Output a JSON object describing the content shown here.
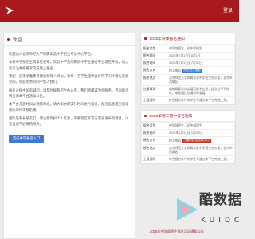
{
  "header": {
    "logo": "school-logo",
    "login": "登录"
  },
  "notice": {
    "title": "欢迎",
    "paragraphs": [
      "欢迎加入北京师范大学附属实验中学招生考试中心平台。",
      "本校中学部招生简章已发布，实验中学及附属初中学生报名平台现已开放，请大家关注并按要求完成网上报名。",
      "我们一直秉承着教育理念和育人目标，为每一名学生提供良好的学习环境与发展空间，欢迎优秀的同学加入我们。",
      "报名过程中如有疑问，请及时联系招生办公室，我们将竭诚为您服务，咨询电话请查阅本平台通知公告。",
      "本平台开放时间以通知为准，请大家合理安排时间进行报名，报名信息提交后请耐心等待审核结果。",
      "团队及家长朋友们，请注意保护个人信息，不要轻信非官方渠道发布的消息，以免造成不必要的损失。"
    ],
    "button": "完成中学报名入口"
  },
  "cards": [
    {
      "title": "2025年秋季报名通知",
      "rows": [
        {
          "k": "报名类型",
          "v": "中学部招生，初中部招生"
        },
        {
          "k": "报名时间",
          "v": "2025年7月1日至8月1日"
        },
        {
          "k": "报名时间",
          "v": "2025年7月1日至7月31日"
        },
        {
          "k": "报名方式",
          "v": "网上报名",
          "tag": "点击进入报名"
        },
        {
          "k": "报名地点",
          "v": "北京师范大学附属实验中学招生办公室，北京市西城区"
        },
        {
          "k": "注意事项",
          "v": "请按照要求如实填写报名信息，提交后不可修改，审核通过后请及时查看。"
        },
        {
          "k": "上报说明",
          "v": "符合报名条件的学生可通过本平台完成上报。"
        }
      ]
    },
    {
      "title": "2025年寒三营中报名通知",
      "rows": [
        {
          "k": "报名类型",
          "v": "中学部招生，初中部招生"
        },
        {
          "k": "报名时间",
          "v": "2025年1月1日至1月20日"
        },
        {
          "k": "报名方式",
          "v": "网上报名",
          "tag": "三营中报名活动入口",
          "red": true
        },
        {
          "k": "报名地点",
          "v": "北京师范大学附属实验中学招生办公室，北京市西城区"
        },
        {
          "k": "上报说明",
          "v": "符合报名条件的学生可通过本平台完成上报。"
        }
      ]
    }
  ],
  "bottom_link": "2025年中学部招生报名活动通知公告",
  "watermark": {
    "cn": "酷数据",
    "en": "KUIDC"
  }
}
